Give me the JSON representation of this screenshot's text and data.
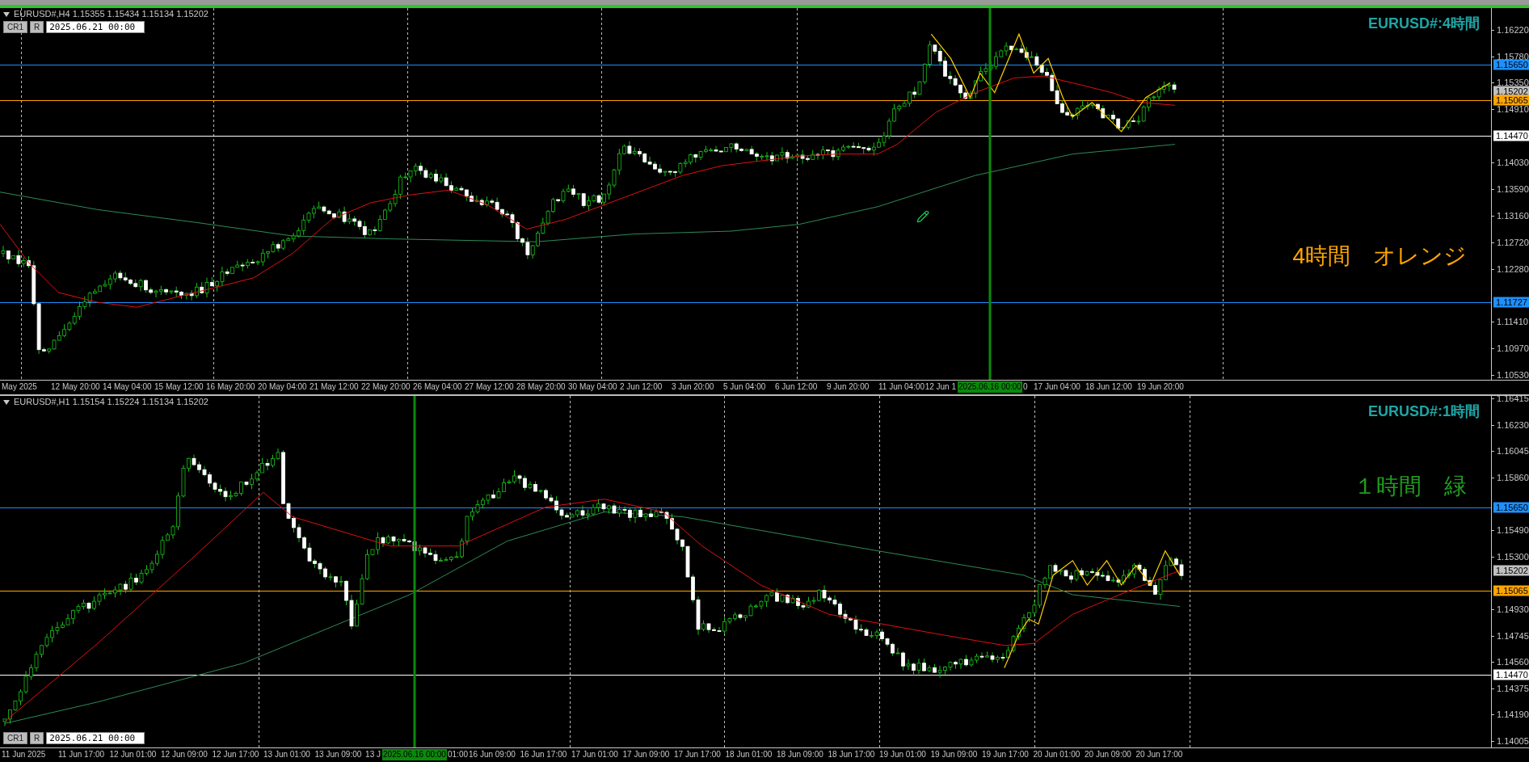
{
  "charts": [
    {
      "header": "EURUSD#,H4 1.15355 1.15434 1.15134 1.15202",
      "buttons": [
        "CR1",
        "R"
      ],
      "date_field": "2025.06.21 00:00",
      "title": "EURUSD#:4時間",
      "note": "4時間　オレンジ",
      "color": "#ffa500",
      "price_ticks": [
        "1.16220",
        "1.15780",
        "1.15350",
        "1.14910",
        "1.14030",
        "1.13590",
        "1.13160",
        "1.12720",
        "1.12280",
        "1.11410",
        "1.10970",
        "1.10530"
      ],
      "levels": [
        {
          "value": "1.15650",
          "color": "#1e90ff",
          "line": true
        },
        {
          "value": "1.15202",
          "color": "#c0c0c0",
          "line": false
        },
        {
          "value": "1.15065",
          "color": "#ffa500",
          "line": true
        },
        {
          "value": "1.14470",
          "color": "#ffffff",
          "line": true
        },
        {
          "value": "1.11727",
          "color": "#1e90ff",
          "line": true
        }
      ],
      "time_labels": [
        {
          "text": "May 2025",
          "kind": "label"
        },
        {
          "text": "12 May 20:00",
          "kind": "label"
        },
        {
          "text": "14 May 04:00",
          "kind": "label"
        },
        {
          "text": "15 May 12:00",
          "kind": "label"
        },
        {
          "text": "16 May 20:00",
          "kind": "label"
        },
        {
          "text": "20 May 04:00",
          "kind": "label"
        },
        {
          "text": "21 May 12:00",
          "kind": "label"
        },
        {
          "text": "22 May 20:00",
          "kind": "label"
        },
        {
          "text": "26 May 04:00",
          "kind": "label"
        },
        {
          "text": "27 May 12:00",
          "kind": "label"
        },
        {
          "text": "28 May 20:00",
          "kind": "label"
        },
        {
          "text": "30 May 04:00",
          "kind": "label"
        },
        {
          "text": "2 Jun 12:00",
          "kind": "label"
        },
        {
          "text": "3 Jun 20:00",
          "kind": "label"
        },
        {
          "text": "5 Jun 04:00",
          "kind": "label"
        },
        {
          "text": "6 Jun 12:00",
          "kind": "label"
        },
        {
          "text": "9 Jun 20:00",
          "kind": "label"
        },
        {
          "text": "11 Jun 04:00",
          "kind": "label"
        },
        {
          "text": "12 Jun 1",
          "kind": "head"
        },
        {
          "text": "0",
          "kind": "tail"
        },
        {
          "text": "17 Jun 04:00",
          "kind": "label"
        },
        {
          "text": "18 Jun 12:00",
          "kind": "label"
        },
        {
          "text": "19 Jun 20:00",
          "kind": "label"
        }
      ],
      "cursor_label": "2025.06.16 00:00"
    },
    {
      "header": "EURUSD#,H1 1.15154 1.15224 1.15134 1.15202",
      "buttons": [
        "CR1",
        "R"
      ],
      "date_field": "2025.06.21 00:00",
      "title": "EURUSD#:1時間",
      "note": "１時間　緑",
      "color": "#1e9e1e",
      "price_ticks": [
        "1.16415",
        "1.16230",
        "1.16045",
        "1.15860",
        "1.15490",
        "1.15300",
        "1.14930",
        "1.14745",
        "1.14560",
        "1.14375",
        "1.14190",
        "1.14005"
      ],
      "levels": [
        {
          "value": "1.15650",
          "color": "#1e90ff",
          "line": true
        },
        {
          "value": "1.15202",
          "color": "#c0c0c0",
          "line": false
        },
        {
          "value": "1.15065",
          "color": "#ffa500",
          "line": true
        },
        {
          "value": "1.14470",
          "color": "#ffffff",
          "line": true
        }
      ],
      "time_labels": [
        {
          "text": "11 Jun 2025",
          "kind": "label"
        },
        {
          "text": "11 Jun 17:00",
          "kind": "label"
        },
        {
          "text": "12 Jun 01:00",
          "kind": "label"
        },
        {
          "text": "12 Jun 09:00",
          "kind": "label"
        },
        {
          "text": "12 Jun 17:00",
          "kind": "label"
        },
        {
          "text": "13 Jun 01:00",
          "kind": "label"
        },
        {
          "text": "13 Jun 09:00",
          "kind": "label"
        },
        {
          "text": "13 J",
          "kind": "head"
        },
        {
          "text": "01:00",
          "kind": "tail"
        },
        {
          "text": "16 Jun 09:00",
          "kind": "label"
        },
        {
          "text": "16 Jun 17:00",
          "kind": "label"
        },
        {
          "text": "17 Jun 01:00",
          "kind": "label"
        },
        {
          "text": "17 Jun 09:00",
          "kind": "label"
        },
        {
          "text": "17 Jun 17:00",
          "kind": "label"
        },
        {
          "text": "18 Jun 01:00",
          "kind": "label"
        },
        {
          "text": "18 Jun 09:00",
          "kind": "label"
        },
        {
          "text": "18 Jun 17:00",
          "kind": "label"
        },
        {
          "text": "19 Jun 01:00",
          "kind": "label"
        },
        {
          "text": "19 Jun 09:00",
          "kind": "label"
        },
        {
          "text": "19 Jun 17:00",
          "kind": "label"
        },
        {
          "text": "20 Jun 01:00",
          "kind": "label"
        },
        {
          "text": "20 Jun 09:00",
          "kind": "label"
        },
        {
          "text": "20 Jun 17:00",
          "kind": "label"
        }
      ],
      "cursor_label": "2025.06.16 00:00"
    }
  ]
}
